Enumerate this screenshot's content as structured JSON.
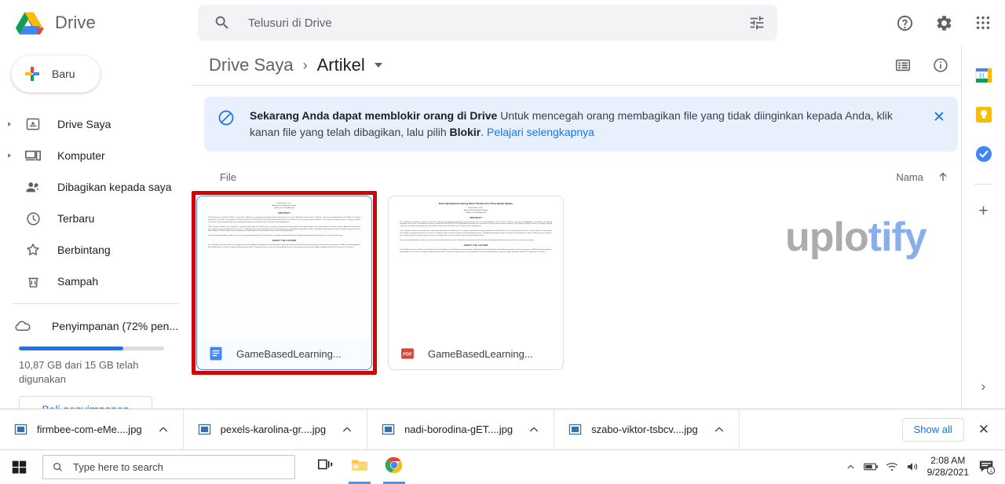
{
  "app": {
    "brand_name": "Drive",
    "logo_icon": "drive-logo-icon"
  },
  "search": {
    "placeholder": "Telusuri di Drive",
    "value": "",
    "search_icon": "search-icon",
    "tune_icon": "tune-filter-icon"
  },
  "header_actions": [
    {
      "name": "help-icon",
      "label": "?"
    },
    {
      "name": "settings-gear-icon",
      "label": ""
    },
    {
      "name": "google-apps-grid-icon",
      "label": ""
    }
  ],
  "sidebar": {
    "new_button": "Baru",
    "items": [
      {
        "label": "Drive Saya",
        "icon": "my-drive-icon",
        "expandable": true
      },
      {
        "label": "Komputer",
        "icon": "computer-icon",
        "expandable": true
      },
      {
        "label": "Dibagikan kepada saya",
        "icon": "shared-with-me-icon",
        "expandable": false
      },
      {
        "label": "Terbaru",
        "icon": "recent-clock-icon",
        "expandable": false
      },
      {
        "label": "Berbintang",
        "icon": "starred-icon",
        "expandable": false
      },
      {
        "label": "Sampah",
        "icon": "trash-icon",
        "expandable": false
      }
    ],
    "storage": {
      "label": "Penyimpanan (72% pen...",
      "icon": "cloud-icon",
      "percent_used": 72,
      "detail": "10,87 GB dari 15 GB telah digunakan",
      "buy_button": "Beli penyimpanan"
    }
  },
  "breadcrumb": {
    "root": "Drive Saya",
    "separator": "›",
    "current": "Artikel"
  },
  "view_tools": [
    {
      "name": "list-view-icon"
    },
    {
      "name": "details-info-icon"
    }
  ],
  "banner": {
    "icon": "block-circle-icon",
    "bold_lead": "Sekarang Anda dapat memblokir orang di Drive",
    "body_1": " Untuk mencegah orang membagikan file yang tidak diinginkan kepada Anda, klik kanan file yang telah dibagikan, lalu pilih ",
    "bold_word": "Blokir",
    "body_2": ". ",
    "link": "Pelajari selengkapnya",
    "close_icon": "close-icon",
    "close_label": "✕"
  },
  "file_list": {
    "section_title": "File",
    "sort_label": "Nama",
    "sort_direction_icon": "arrow-up-icon",
    "sort_arrow": "↑",
    "cards": [
      {
        "name": "GameBasedLearning...",
        "file_type_icon": "google-docs-icon",
        "selected": true,
        "doc": {
          "title": "",
          "byline_1": "Roland Rizzi, Ph.D.",
          "byline_2": "Advanced Distributed Learning",
          "byline_3": "roland.rizzi.civ@adlnet.gov",
          "heading": "ABSTRACT",
          "author_heading": "ABOUT THE AUTHOR"
        }
      },
      {
        "name": "GameBasedLearning...",
        "file_type_icon": "pdf-icon",
        "selected": false,
        "doc": {
          "title": "Does Game-Based Learning Work? Results from Three Recent Studies",
          "byline_1": "Roland Rizzi, Ph.D.",
          "byline_2": "Advanced Distributed Learning",
          "byline_3": "roland.rizzi.civ@adlnet.gov",
          "heading": "ABSTRACT",
          "author_heading": "ABOUT THE AUTHOR"
        }
      }
    ],
    "doc_paragraphs": [
      "The Department of Defense (DoD) is faced with challenges in expanding technology based solutions that can make Warfighters more efficient, effective, and more knowledgeable, and flexible. Of growing importance to the DoD is the potential of using Commercial Off-the-Shelf (COTS) game-based learning in the armed forces for increasing combat readiness. The missions of today, however, are highly complex and varied, such that training objectives and problem solving must be dealt with at a deeper level of engagement.",
      "Three research studies were conducted to systematically examine the differences in academic achievement among students who did and did not use video games for learning. These difference video games were added to approximately half the courses at Oklahoma State University Research and Technology courses, Job Aids Intermediate courses, and 3rd year Management courses. Material among situations were tested in all courses within state achievement included gains that were certain, similar, otherwise and gain-affect.",
      "These studies add definitive evidence to the area of game-based learning. The field now has studies proving the efficiency of digital game-based learning and how it can improve learning.",
      "Dr. Ryck Blues, Director of Plans and Programs for the DoD Advanced Distributed Learning Initiative, graduated from the United States Naval Academy and served his commission in 1985. He was designated a Naval Flight Officer in 1991 as a Fighter Radar Intercept Officer. During his 20-year career he commanded the units of Commander and served with Fighter Squadron 143 and 171 flying the F-14 Tomcat."
    ]
  },
  "watermark": {
    "part_gray": "uplo",
    "part_blue": "tify",
    "color_gray": "#9b9b9b",
    "color_blue": "#6f9de8"
  },
  "right_rail": {
    "items": [
      {
        "name": "google-calendar-icon",
        "label": "31"
      },
      {
        "name": "google-keep-icon",
        "label": ""
      },
      {
        "name": "google-tasks-icon",
        "label": ""
      }
    ],
    "add_label": "+",
    "expand_label": "›"
  },
  "download_bar": {
    "items": [
      {
        "name": "firmbee-com-eMe....jpg",
        "icon": "image-file-icon",
        "caret": "⌃"
      },
      {
        "name": "pexels-karolina-gr....jpg",
        "icon": "image-file-icon",
        "caret": "⌃"
      },
      {
        "name": "nadi-borodina-gET....jpg",
        "icon": "image-file-icon",
        "caret": "⌃"
      },
      {
        "name": "szabo-viktor-tsbcv....jpg",
        "icon": "image-file-icon",
        "caret": "⌃"
      }
    ],
    "show_all": "Show all",
    "close_label": "✕"
  },
  "taskbar": {
    "start_icon": "windows-start-icon",
    "search_placeholder": "Type here to search",
    "search_icon": "search-icon",
    "apps": [
      {
        "name": "task-view-icon"
      },
      {
        "name": "file-explorer-icon"
      },
      {
        "name": "google-chrome-icon"
      }
    ],
    "tray": {
      "chevron": "⌃",
      "battery_icon": "battery-icon",
      "network_icon": "wifi-icon",
      "volume_icon": "volume-icon",
      "time": "2:08 AM",
      "date": "9/28/2021",
      "notification_icon": "notification-icon",
      "notification_count": "1"
    }
  },
  "colors": {
    "accent_blue": "#1a73e8",
    "banner_bg": "#e8f0fe",
    "selection_red": "#d00505",
    "pdf_red": "#db4437"
  }
}
